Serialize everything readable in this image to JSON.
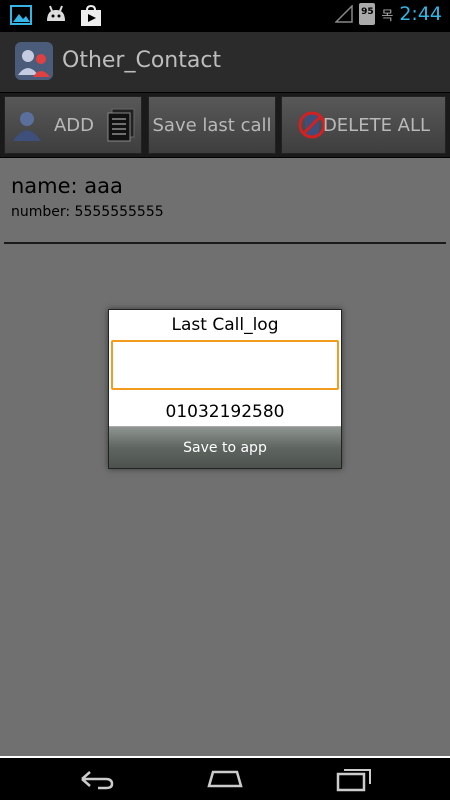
{
  "status_bar": {
    "left_icons": [
      "gallery-icon",
      "android-icon",
      "play-store-icon"
    ],
    "battery_level": "95",
    "day_char": "목",
    "time": "2:44",
    "accent_color": "#33b5e5"
  },
  "action_bar": {
    "title": "Other_Contact"
  },
  "toolbar": {
    "add_label": "ADD",
    "save_last_call_label": "Save last call",
    "delete_all_label": "DELETE ALL"
  },
  "contact": {
    "name": "name: aaa",
    "number": "number: 5555555555"
  },
  "dialog": {
    "title": "Last Call_log",
    "input_value": "",
    "number": "01032192580",
    "save_button_label": "Save to app",
    "input_border_color": "#f39b1c"
  },
  "nav_bar": {
    "icons": [
      "back-icon",
      "home-icon",
      "recent-apps-icon"
    ]
  }
}
